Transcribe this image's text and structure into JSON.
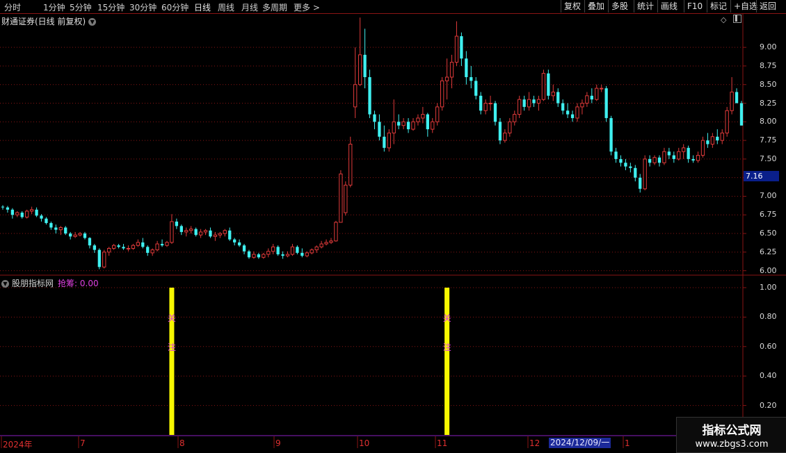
{
  "toolbar": {
    "timeframes": [
      "分时",
      "1分钟",
      "5分钟",
      "15分钟",
      "30分钟",
      "60分钟",
      "日线",
      "周线",
      "月线",
      "多周期",
      "更多 >"
    ],
    "active_timeframe": "日线",
    "buttons": [
      "复权",
      "叠加",
      "多股",
      "统计",
      "画线",
      "F10",
      "标记",
      "+自选",
      "返回"
    ]
  },
  "main_chart": {
    "title": "财通证券(日线 前复权)",
    "price_ticks": [
      "9.00",
      "8.75",
      "8.50",
      "8.25",
      "8.00",
      "7.75",
      "7.50",
      "7.25",
      "7.00",
      "6.75",
      "6.50",
      "6.25",
      "6.00"
    ],
    "current_price": "7.16"
  },
  "indicator": {
    "name": "股朋指标网",
    "label": "抢筹:",
    "value": "0.00",
    "ticks": [
      "1.00",
      "0.80",
      "0.60",
      "0.40",
      "0.20"
    ],
    "marker_chars": [
      "关",
      "注"
    ]
  },
  "x_axis": {
    "labels": [
      "2024年",
      "7",
      "8",
      "9",
      "10",
      "11",
      "12",
      "1"
    ],
    "cursor_label": "2024/12/09/一"
  },
  "watermark": {
    "line1": "指标公式网",
    "line2": "www.zbgs3.com"
  },
  "chart_data": {
    "type": "candlestick",
    "title": "财通证券(日线 前复权)",
    "ylim": [
      5.95,
      9.3
    ],
    "colors": {
      "up": "#e03a3a",
      "down": "#3ff0f0",
      "signal": "#f7f700",
      "grid": "#8a1414"
    },
    "candles": [
      [
        6.86,
        6.88,
        6.82,
        6.85
      ],
      [
        6.85,
        6.87,
        6.78,
        6.82
      ],
      [
        6.82,
        6.84,
        6.7,
        6.75
      ],
      [
        6.75,
        6.8,
        6.72,
        6.78
      ],
      [
        6.78,
        6.8,
        6.7,
        6.72
      ],
      [
        6.72,
        6.82,
        6.7,
        6.8
      ],
      [
        6.8,
        6.86,
        6.76,
        6.82
      ],
      [
        6.82,
        6.85,
        6.72,
        6.74
      ],
      [
        6.74,
        6.76,
        6.66,
        6.7
      ],
      [
        6.7,
        6.72,
        6.62,
        6.64
      ],
      [
        6.64,
        6.66,
        6.55,
        6.58
      ],
      [
        6.58,
        6.62,
        6.5,
        6.55
      ],
      [
        6.55,
        6.6,
        6.48,
        6.58
      ],
      [
        6.58,
        6.6,
        6.48,
        6.5
      ],
      [
        6.5,
        6.52,
        6.42,
        6.46
      ],
      [
        6.46,
        6.52,
        6.44,
        6.48
      ],
      [
        6.48,
        6.52,
        6.46,
        6.5
      ],
      [
        6.5,
        6.52,
        6.42,
        6.44
      ],
      [
        6.44,
        6.45,
        6.3,
        6.34
      ],
      [
        6.34,
        6.36,
        6.24,
        6.28
      ],
      [
        6.28,
        6.3,
        6.02,
        6.05
      ],
      [
        6.05,
        6.28,
        6.03,
        6.25
      ],
      [
        6.25,
        6.32,
        6.2,
        6.3
      ],
      [
        6.3,
        6.36,
        6.28,
        6.34
      ],
      [
        6.34,
        6.36,
        6.3,
        6.32
      ],
      [
        6.32,
        6.36,
        6.28,
        6.3
      ],
      [
        6.3,
        6.34,
        6.26,
        6.3
      ],
      [
        6.3,
        6.36,
        6.28,
        6.34
      ],
      [
        6.34,
        6.42,
        6.32,
        6.38
      ],
      [
        6.38,
        6.44,
        6.3,
        6.32
      ],
      [
        6.32,
        6.34,
        6.2,
        6.24
      ],
      [
        6.24,
        6.3,
        6.2,
        6.28
      ],
      [
        6.28,
        6.4,
        6.26,
        6.36
      ],
      [
        6.36,
        6.42,
        6.32,
        6.34
      ],
      [
        6.34,
        6.4,
        6.32,
        6.38
      ],
      [
        6.38,
        6.76,
        6.36,
        6.66
      ],
      [
        6.66,
        6.7,
        6.56,
        6.6
      ],
      [
        6.6,
        6.62,
        6.48,
        6.52
      ],
      [
        6.52,
        6.58,
        6.46,
        6.54
      ],
      [
        6.54,
        6.6,
        6.5,
        6.56
      ],
      [
        6.56,
        6.58,
        6.46,
        6.48
      ],
      [
        6.48,
        6.56,
        6.44,
        6.52
      ],
      [
        6.52,
        6.56,
        6.48,
        6.54
      ],
      [
        6.54,
        6.58,
        6.44,
        6.46
      ],
      [
        6.46,
        6.52,
        6.4,
        6.48
      ],
      [
        6.48,
        6.52,
        6.44,
        6.5
      ],
      [
        6.5,
        6.56,
        6.46,
        6.54
      ],
      [
        6.54,
        6.58,
        6.4,
        6.42
      ],
      [
        6.42,
        6.44,
        6.34,
        6.38
      ],
      [
        6.38,
        6.42,
        6.32,
        6.34
      ],
      [
        6.34,
        6.36,
        6.22,
        6.26
      ],
      [
        6.26,
        6.28,
        6.16,
        6.18
      ],
      [
        6.18,
        6.26,
        6.16,
        6.22
      ],
      [
        6.22,
        6.24,
        6.16,
        6.18
      ],
      [
        6.18,
        6.24,
        6.16,
        6.22
      ],
      [
        6.22,
        6.3,
        6.18,
        6.26
      ],
      [
        6.26,
        6.36,
        6.22,
        6.32
      ],
      [
        6.32,
        6.34,
        6.2,
        6.22
      ],
      [
        6.22,
        6.26,
        6.16,
        6.2
      ],
      [
        6.2,
        6.26,
        6.18,
        6.22
      ],
      [
        6.22,
        6.36,
        6.2,
        6.32
      ],
      [
        6.32,
        6.34,
        6.22,
        6.24
      ],
      [
        6.24,
        6.3,
        6.18,
        6.2
      ],
      [
        6.2,
        6.26,
        6.18,
        6.24
      ],
      [
        6.24,
        6.3,
        6.22,
        6.28
      ],
      [
        6.28,
        6.34,
        6.24,
        6.32
      ],
      [
        6.32,
        6.4,
        6.3,
        6.36
      ],
      [
        6.36,
        6.42,
        6.34,
        6.38
      ],
      [
        6.38,
        6.44,
        6.36,
        6.4
      ],
      [
        6.4,
        6.67,
        6.39,
        6.65
      ],
      [
        6.65,
        7.35,
        6.75,
        7.3
      ],
      [
        6.78,
        7.2,
        6.74,
        7.15
      ],
      [
        7.15,
        7.8,
        7.12,
        7.7
      ],
      [
        8.2,
        9.0,
        8.05,
        8.5
      ],
      [
        8.5,
        9.4,
        8.48,
        8.9
      ],
      [
        8.9,
        9.25,
        8.45,
        8.6
      ],
      [
        8.6,
        8.7,
        8.05,
        8.1
      ],
      [
        8.1,
        8.15,
        7.9,
        8.0
      ],
      [
        8.0,
        8.1,
        7.75,
        7.8
      ],
      [
        7.8,
        7.95,
        7.6,
        7.65
      ],
      [
        7.65,
        7.9,
        7.6,
        7.85
      ],
      [
        7.85,
        8.3,
        7.7,
        8.0
      ],
      [
        8.0,
        8.1,
        7.9,
        7.95
      ],
      [
        7.95,
        8.05,
        7.9,
        8.0
      ],
      [
        8.0,
        8.05,
        7.85,
        7.9
      ],
      [
        7.9,
        8.05,
        7.88,
        8.0
      ],
      [
        8.0,
        8.1,
        7.95,
        8.05
      ],
      [
        8.05,
        8.2,
        7.98,
        8.1
      ],
      [
        8.1,
        8.12,
        7.8,
        7.9
      ],
      [
        7.9,
        8.05,
        7.85,
        8.0
      ],
      [
        8.0,
        8.25,
        7.95,
        8.2
      ],
      [
        8.2,
        8.6,
        8.15,
        8.55
      ],
      [
        8.55,
        8.85,
        8.3,
        8.6
      ],
      [
        8.6,
        8.9,
        8.45,
        8.8
      ],
      [
        8.8,
        9.35,
        8.75,
        9.15
      ],
      [
        9.15,
        9.2,
        8.75,
        8.85
      ],
      [
        8.85,
        8.95,
        8.5,
        8.6
      ],
      [
        8.6,
        8.75,
        8.45,
        8.55
      ],
      [
        8.55,
        8.6,
        8.3,
        8.35
      ],
      [
        8.35,
        8.4,
        8.1,
        8.15
      ],
      [
        8.15,
        8.3,
        8.1,
        8.25
      ],
      [
        8.25,
        8.35,
        8.15,
        8.25
      ],
      [
        8.25,
        8.28,
        7.95,
        8.0
      ],
      [
        8.0,
        8.05,
        7.7,
        7.75
      ],
      [
        7.75,
        7.9,
        7.72,
        7.85
      ],
      [
        7.85,
        8.05,
        7.8,
        8.0
      ],
      [
        8.0,
        8.15,
        7.95,
        8.1
      ],
      [
        8.1,
        8.35,
        8.05,
        8.3
      ],
      [
        8.3,
        8.35,
        8.15,
        8.2
      ],
      [
        8.2,
        8.4,
        8.15,
        8.3
      ],
      [
        8.3,
        8.35,
        8.2,
        8.25
      ],
      [
        8.25,
        8.35,
        8.15,
        8.3
      ],
      [
        8.3,
        8.7,
        8.28,
        8.65
      ],
      [
        8.65,
        8.7,
        8.3,
        8.35
      ],
      [
        8.35,
        8.5,
        8.28,
        8.4
      ],
      [
        8.4,
        8.45,
        8.2,
        8.25
      ],
      [
        8.25,
        8.3,
        8.1,
        8.15
      ],
      [
        8.15,
        8.25,
        8.05,
        8.1
      ],
      [
        8.1,
        8.15,
        8.0,
        8.05
      ],
      [
        8.05,
        8.25,
        8.0,
        8.2
      ],
      [
        8.2,
        8.3,
        8.1,
        8.25
      ],
      [
        8.25,
        8.4,
        8.2,
        8.35
      ],
      [
        8.35,
        8.45,
        8.25,
        8.3
      ],
      [
        8.3,
        8.5,
        8.28,
        8.45
      ],
      [
        8.45,
        8.5,
        8.4,
        8.45
      ],
      [
        8.45,
        8.48,
        8.0,
        8.05
      ],
      [
        8.05,
        8.08,
        7.55,
        7.6
      ],
      [
        7.6,
        7.65,
        7.45,
        7.5
      ],
      [
        7.5,
        7.55,
        7.4,
        7.45
      ],
      [
        7.45,
        7.5,
        7.35,
        7.4
      ],
      [
        7.4,
        7.45,
        7.32,
        7.38
      ],
      [
        7.38,
        7.42,
        7.2,
        7.25
      ],
      [
        7.25,
        7.3,
        7.05,
        7.1
      ],
      [
        7.1,
        7.55,
        7.08,
        7.5
      ],
      [
        7.5,
        7.55,
        7.4,
        7.45
      ],
      [
        7.45,
        7.55,
        7.42,
        7.52
      ],
      [
        7.52,
        7.55,
        7.4,
        7.45
      ],
      [
        7.45,
        7.65,
        7.42,
        7.6
      ],
      [
        7.6,
        7.65,
        7.5,
        7.55
      ],
      [
        7.55,
        7.6,
        7.45,
        7.5
      ],
      [
        7.5,
        7.65,
        7.48,
        7.6
      ],
      [
        7.6,
        7.7,
        7.5,
        7.65
      ],
      [
        7.65,
        7.68,
        7.45,
        7.5
      ],
      [
        7.5,
        7.55,
        7.45,
        7.48
      ],
      [
        7.48,
        7.6,
        7.45,
        7.55
      ],
      [
        7.55,
        7.8,
        7.52,
        7.75
      ],
      [
        7.75,
        7.85,
        7.65,
        7.7
      ],
      [
        7.7,
        7.85,
        7.65,
        7.8
      ],
      [
        7.8,
        7.9,
        7.7,
        7.75
      ],
      [
        7.75,
        7.9,
        7.7,
        7.85
      ],
      [
        7.85,
        8.2,
        7.8,
        8.15
      ],
      [
        8.15,
        8.6,
        8.1,
        8.4
      ],
      [
        8.4,
        8.45,
        8.25,
        8.25
      ],
      [
        8.25,
        8.28,
        7.95,
        7.95
      ]
    ],
    "signal_bars": [
      {
        "candle_index": 35,
        "value": 1.0
      },
      {
        "candle_index": 92,
        "value": 1.0
      }
    ]
  }
}
